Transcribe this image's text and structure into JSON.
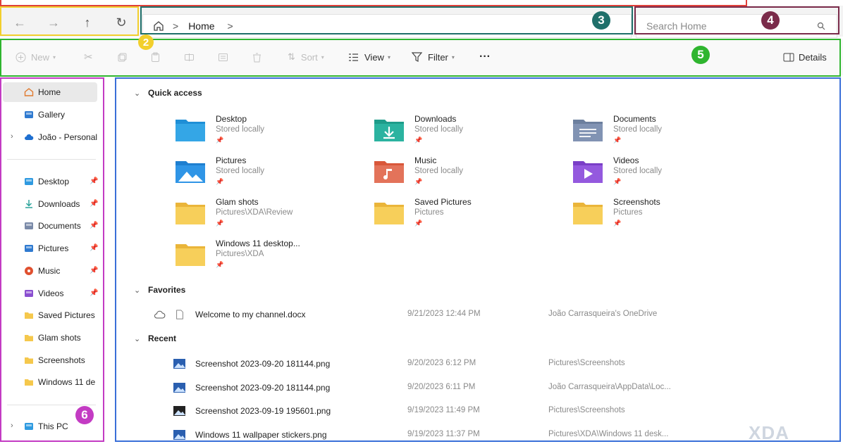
{
  "nav": {
    "back": "←",
    "forward": "→",
    "up": "↑",
    "refresh": "↻"
  },
  "address": {
    "location": "Home",
    "separator": ">",
    "trailing_separator": ">"
  },
  "search": {
    "placeholder": "Search Home"
  },
  "toolbar": {
    "new": "New",
    "sort": "Sort",
    "view": "View",
    "filter": "Filter",
    "more": "···",
    "details": "Details"
  },
  "sidebar": {
    "top": [
      {
        "label": "Home",
        "icon": "home-icon",
        "selected": true
      },
      {
        "label": "Gallery",
        "icon": "gallery-icon"
      },
      {
        "label": "João - Personal",
        "icon": "cloud-icon",
        "expandable": true
      }
    ],
    "pinned": [
      {
        "label": "Desktop",
        "icon": "desktop-icon",
        "pinned": true
      },
      {
        "label": "Downloads",
        "icon": "downloads-icon",
        "pinned": true
      },
      {
        "label": "Documents",
        "icon": "documents-icon",
        "pinned": true
      },
      {
        "label": "Pictures",
        "icon": "pictures-icon",
        "pinned": true
      },
      {
        "label": "Music",
        "icon": "music-icon",
        "pinned": true
      },
      {
        "label": "Videos",
        "icon": "videos-icon",
        "pinned": true
      },
      {
        "label": "Saved Pictures",
        "icon": "folder-icon"
      },
      {
        "label": "Glam shots",
        "icon": "folder-icon"
      },
      {
        "label": "Screenshots",
        "icon": "folder-icon"
      },
      {
        "label": "Windows 11 de",
        "icon": "folder-icon"
      }
    ],
    "this_pc": "This PC"
  },
  "quick_access": {
    "title": "Quick access",
    "items": [
      {
        "name": "Desktop",
        "sub": "Stored locally",
        "icon": "desktop-folder-icon"
      },
      {
        "name": "Downloads",
        "sub": "Stored locally",
        "icon": "downloads-folder-icon"
      },
      {
        "name": "Documents",
        "sub": "Stored locally",
        "icon": "documents-folder-icon"
      },
      {
        "name": "Pictures",
        "sub": "Stored locally",
        "icon": "pictures-folder-icon"
      },
      {
        "name": "Music",
        "sub": "Stored locally",
        "icon": "music-folder-icon"
      },
      {
        "name": "Videos",
        "sub": "Stored locally",
        "icon": "videos-folder-icon"
      },
      {
        "name": "Glam shots",
        "sub": "Pictures\\XDA\\Review",
        "icon": "folder-icon"
      },
      {
        "name": "Saved Pictures",
        "sub": "Pictures",
        "icon": "folder-icon"
      },
      {
        "name": "Screenshots",
        "sub": "Pictures",
        "icon": "folder-icon"
      },
      {
        "name": "Windows 11 desktop...",
        "sub": "Pictures\\XDA",
        "icon": "folder-icon"
      }
    ]
  },
  "favorites": {
    "title": "Favorites",
    "rows": [
      {
        "name": "Welcome to my channel.docx",
        "date": "9/21/2023 12:44 PM",
        "location": "João Carrasqueira's OneDrive"
      }
    ]
  },
  "recent": {
    "title": "Recent",
    "rows": [
      {
        "name": "Screenshot 2023-09-20 181144.png",
        "date": "9/20/2023 6:12 PM",
        "location": "Pictures\\Screenshots"
      },
      {
        "name": "Screenshot 2023-09-20 181144.png",
        "date": "9/20/2023 6:11 PM",
        "location": "João Carrasqueira\\AppData\\Loc..."
      },
      {
        "name": "Screenshot 2023-09-19 195601.png",
        "date": "9/19/2023 11:49 PM",
        "location": "Pictures\\Screenshots"
      },
      {
        "name": "Windows 11 wallpaper stickers.png",
        "date": "9/19/2023 11:37 PM",
        "location": "Pictures\\XDA\\Windows 11 desk..."
      }
    ]
  },
  "annotations": {
    "b2": "2",
    "b3": "3",
    "b4": "4",
    "b5": "5",
    "b6": "6"
  },
  "watermark": "XDA",
  "colors": {
    "red_frame": "#e0403a",
    "yellow_frame": "#f2cf2c",
    "teal_frame": "#1f6f6a",
    "maroon_frame": "#7a2b4a",
    "green_frame": "#2fb52f",
    "magenta_frame": "#c33bc3",
    "blue_frame": "#3a6fd8",
    "folder_yellow": "#f5c84c"
  }
}
